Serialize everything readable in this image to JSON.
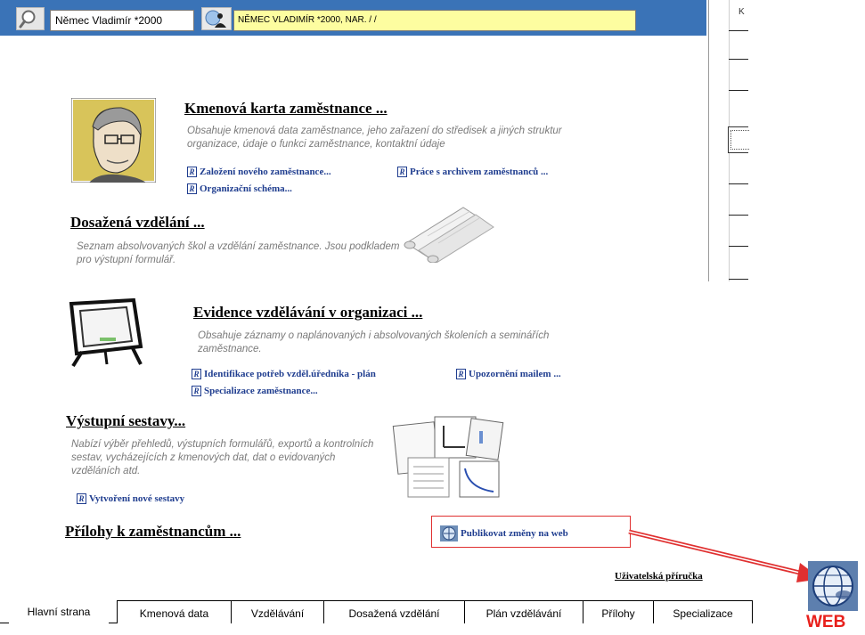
{
  "header": {
    "employee_name": "Němec Vladimír *2000",
    "employee_info": "NĚMEC VLADIMÍR *2000, NAR. / /",
    "right_panel_letter": "K"
  },
  "sections": {
    "employee_card": {
      "title": "Kmenová karta zaměstnance ...",
      "description": "Obsahuje kmenová data zaměstnance, jeho zařazení do středisek a jiných struktur organizace, údaje o funkci zaměstnance, kontaktní údaje",
      "links": [
        "Založení nového zaměstnance...",
        "Práce s archivem zaměstnanců ...",
        "Organizační schéma..."
      ]
    },
    "education_achieved": {
      "title": "Dosažená vzdělání ...",
      "description": "Seznam absolvovaných škol a vzdělání zaměstnance. Jsou podkladem pro výstupní formulář."
    },
    "training_records": {
      "title": "Evidence vzdělávání v organizaci ...",
      "description": "Obsahuje záznamy o naplánovaných i absolvovaných školeních a seminářích zaměstnance.",
      "links": [
        "Identifikace potřeb vzděl.úředníka - plán",
        "Upozornění mailem ...",
        "Specializace zaměstnance..."
      ]
    },
    "output_reports": {
      "title": "Výstupní sestavy...",
      "description": "Nabízí výběr přehledů, výstupních formulářů, exportů a kontrolních sestav, vycházejících z kmenových dat, dat o evidovaných vzděláních atd.",
      "links": [
        "Vytvoření nové sestavy"
      ]
    },
    "attachments": {
      "title": "Přílohy k zaměstnancům ..."
    }
  },
  "publish": {
    "label": "Publikovat změny na web"
  },
  "manual_link": "Uživatelská příručka",
  "web_label": "WEB",
  "tabs": [
    "Hlavní strana",
    "Kmenová data",
    "Vzdělávání",
    "Dosažená vzdělání",
    "Plán vzdělávání",
    "Přílohy",
    "Specializace"
  ],
  "active_tab": "Hlavní strana",
  "icons": {
    "search": "magnifier-icon",
    "picker": "person-pick-icon",
    "link": "r-link-icon",
    "web": "globe-icon"
  },
  "colors": {
    "topbar": "#3a73b7",
    "info_field": "#fdfda0",
    "link": "#1f3d8f",
    "accent_red": "#e03030"
  }
}
